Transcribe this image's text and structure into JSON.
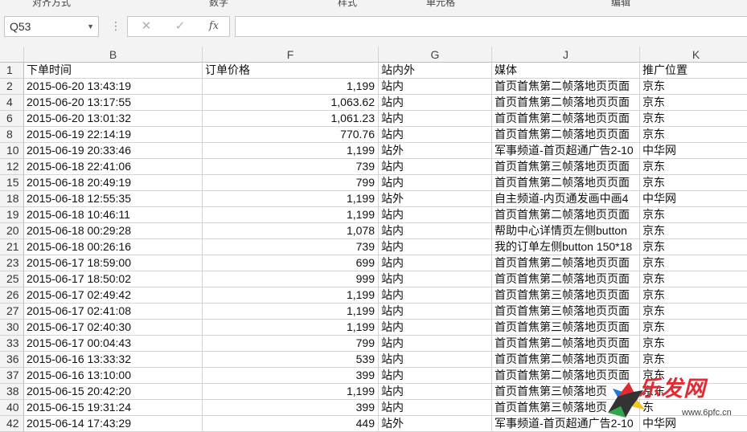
{
  "ribbon": {
    "fragments": [
      "对齐方式",
      "数字",
      "样式",
      "单元格",
      "编辑"
    ]
  },
  "formula_bar": {
    "name_box": "Q53",
    "dropdown_glyph": "▼",
    "dots_glyph": "⋮",
    "cancel_glyph": "✕",
    "enter_glyph": "✓",
    "fx_label": "fx",
    "formula_value": ""
  },
  "columns": [
    {
      "letter": "B"
    },
    {
      "letter": "F"
    },
    {
      "letter": "G"
    },
    {
      "letter": "J"
    },
    {
      "letter": "K"
    }
  ],
  "rows": [
    {
      "n": "1",
      "b": "下单时间",
      "f": "订单价格",
      "g": "站内外",
      "j": "媒体",
      "k": "推广位置"
    },
    {
      "n": "2",
      "b": "2015-06-20 13:43:19",
      "f": "1,199",
      "g": "站内",
      "j": "首页首焦第二帧落地页页面",
      "k": "京东"
    },
    {
      "n": "4",
      "b": "2015-06-20 13:17:55",
      "f": "1,063.62",
      "g": "站内",
      "j": "首页首焦第二帧落地页页面",
      "k": "京东"
    },
    {
      "n": "6",
      "b": "2015-06-20 13:01:32",
      "f": "1,061.23",
      "g": "站内",
      "j": "首页首焦第二帧落地页页面",
      "k": "京东"
    },
    {
      "n": "8",
      "b": "2015-06-19 22:14:19",
      "f": "770.76",
      "g": "站内",
      "j": "首页首焦第二帧落地页页面",
      "k": "京东"
    },
    {
      "n": "10",
      "b": "2015-06-19 20:33:46",
      "f": "1,199",
      "g": "站外",
      "j": "军事频道-首页超通广告2-10",
      "k": "中华网"
    },
    {
      "n": "12",
      "b": "2015-06-18 22:41:06",
      "f": "739",
      "g": "站内",
      "j": "首页首焦第三帧落地页页面",
      "k": "京东"
    },
    {
      "n": "15",
      "b": "2015-06-18 20:49:19",
      "f": "799",
      "g": "站内",
      "j": "首页首焦第二帧落地页页面",
      "k": "京东"
    },
    {
      "n": "18",
      "b": "2015-06-18 12:55:35",
      "f": "1,199",
      "g": "站外",
      "j": "自主频道-内页通发画中画4",
      "k": "中华网"
    },
    {
      "n": "19",
      "b": "2015-06-18 10:46:11",
      "f": "1,199",
      "g": "站内",
      "j": "首页首焦第二帧落地页页面",
      "k": "京东"
    },
    {
      "n": "20",
      "b": "2015-06-18 00:29:28",
      "f": "1,078",
      "g": "站内",
      "j": "帮助中心详情页左侧button",
      "k": "京东"
    },
    {
      "n": "21",
      "b": "2015-06-18 00:26:16",
      "f": "739",
      "g": "站内",
      "j": "我的订单左侧button 150*18",
      "k": "京东"
    },
    {
      "n": "23",
      "b": "2015-06-17 18:59:00",
      "f": "699",
      "g": "站内",
      "j": "首页首焦第二帧落地页页面",
      "k": "京东"
    },
    {
      "n": "25",
      "b": "2015-06-17 18:50:02",
      "f": "999",
      "g": "站内",
      "j": "首页首焦第二帧落地页页面",
      "k": "京东"
    },
    {
      "n": "26",
      "b": "2015-06-17 02:49:42",
      "f": "1,199",
      "g": "站内",
      "j": "首页首焦第三帧落地页页面",
      "k": "京东"
    },
    {
      "n": "27",
      "b": "2015-06-17 02:41:08",
      "f": "1,199",
      "g": "站内",
      "j": "首页首焦第三帧落地页页面",
      "k": "京东"
    },
    {
      "n": "30",
      "b": "2015-06-17 02:40:30",
      "f": "1,199",
      "g": "站内",
      "j": "首页首焦第三帧落地页页面",
      "k": "京东"
    },
    {
      "n": "33",
      "b": "2015-06-17 00:04:43",
      "f": "799",
      "g": "站内",
      "j": "首页首焦第二帧落地页页面",
      "k": "京东"
    },
    {
      "n": "36",
      "b": "2015-06-16 13:33:32",
      "f": "539",
      "g": "站内",
      "j": "首页首焦第二帧落地页页面",
      "k": "京东"
    },
    {
      "n": "37",
      "b": "2015-06-16 13:10:00",
      "f": "399",
      "g": "站内",
      "j": "首页首焦第二帧落地页页面",
      "k": "京东"
    },
    {
      "n": "38",
      "b": "2015-06-15 20:42:20",
      "f": "1,199",
      "g": "站内",
      "j": "首页首焦第三帧落地页",
      "k": "京东"
    },
    {
      "n": "40",
      "b": "2015-06-15 19:31:24",
      "f": "399",
      "g": "站内",
      "j": "首页首焦第三帧落地页",
      "k": "东"
    },
    {
      "n": "42",
      "b": "2015-06-14 17:43:29",
      "f": "449",
      "g": "站外",
      "j": "军事频道-首页超通广告2-10",
      "k": "中华网"
    }
  ],
  "watermark": {
    "logo_text": "乐发网",
    "url": "www.6pfc.cn",
    "colors": {
      "red": "#e12a32",
      "dark": "#333333",
      "yellow": "#f5c518",
      "green": "#2aa84a"
    }
  }
}
